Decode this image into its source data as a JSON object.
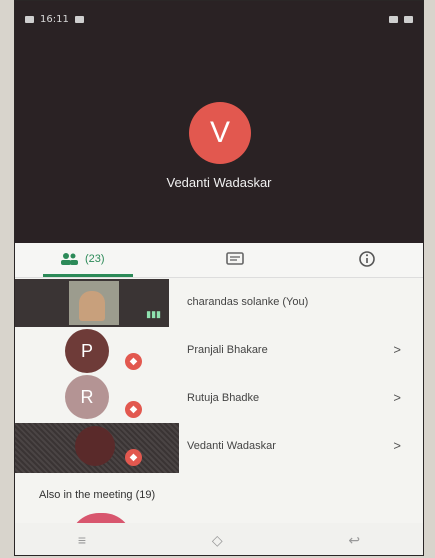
{
  "statusbar": {
    "left_text": "16:11",
    "right_text": ""
  },
  "host": {
    "initial": "V",
    "name": "Vedanti Wadaskar"
  },
  "tabs": {
    "people_count": "(23)"
  },
  "participants": [
    {
      "name": "charandas solanke (You)"
    },
    {
      "initial": "P",
      "name": "Pranjali Bhakare"
    },
    {
      "initial": "R",
      "name": "Rutuja Bhadke"
    },
    {
      "name": "Vedanti Wadaskar"
    }
  ],
  "also_in_meeting": "Also in the meeting (19)",
  "colors": {
    "accent": "#2c8a58",
    "avatar_red": "#e2584f",
    "mute_red": "#e2584f"
  },
  "icons": [
    "people-icon",
    "chat-icon",
    "info-icon",
    "mic-off-icon",
    "chevron-right-icon",
    "menu-icon",
    "home-icon",
    "back-icon"
  ]
}
